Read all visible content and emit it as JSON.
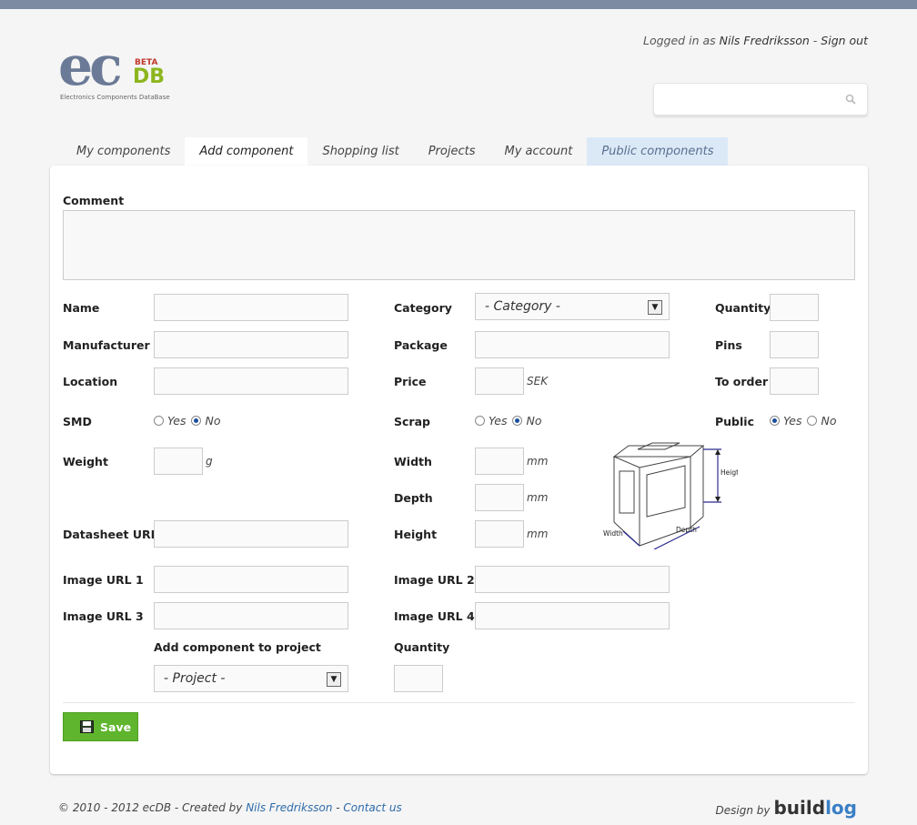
{
  "header": {
    "logged_in_prefix": "Logged in as",
    "user_name": "Nils Fredriksson",
    "separator": " - ",
    "sign_out": "Sign out"
  },
  "logo": {
    "ec": "ec",
    "db": "DB",
    "beta": "BETA",
    "tagline": "Electronics Components DataBase"
  },
  "search": {
    "placeholder": ""
  },
  "tabs": [
    {
      "label": "My components"
    },
    {
      "label": "Add component"
    },
    {
      "label": "Shopping list"
    },
    {
      "label": "Projects"
    },
    {
      "label": "My account"
    },
    {
      "label": "Public components"
    }
  ],
  "form": {
    "comment_label": "Comment",
    "name_label": "Name",
    "manufacturer_label": "Manufacturer",
    "location_label": "Location",
    "smd_label": "SMD",
    "weight_label": "Weight",
    "weight_unit": "g",
    "datasheet_label": "Datasheet URL",
    "image1_label": "Image URL 1",
    "image2_label": "Image URL 2",
    "image3_label": "Image URL 3",
    "image4_label": "Image URL 4",
    "category_label": "Category",
    "category_value": "- Category -",
    "package_label": "Package",
    "price_label": "Price",
    "price_unit": "SEK",
    "scrap_label": "Scrap",
    "width_label": "Width",
    "depth_label": "Depth",
    "height_label": "Height",
    "mm": "mm",
    "quantity_label": "Quantity",
    "pins_label": "Pins",
    "to_order_label": "To order",
    "public_label": "Public",
    "yes": "Yes",
    "no": "No",
    "add_to_project_label": "Add component to project",
    "project_value": "- Project -",
    "project_quantity_label": "Quantity",
    "smd_value": "No",
    "scrap_value": "No",
    "public_value": "Yes"
  },
  "diagram": {
    "heigth": "Heigth",
    "width": "Width",
    "depth": "Depth"
  },
  "save_label": "Save",
  "footer": {
    "copyright": "© 2010 - 2012 ecDB - Created by",
    "author": "Nils Fredriksson",
    "dash": " - ",
    "contact": "Contact us",
    "design_by": "Design by",
    "brand_a": "build",
    "brand_b": "log"
  },
  "colors": {
    "topbar": "#7c8ba1",
    "save_green": "#5fb52d",
    "public_tab": "#dbe9f7",
    "link": "#2d6aa9"
  }
}
